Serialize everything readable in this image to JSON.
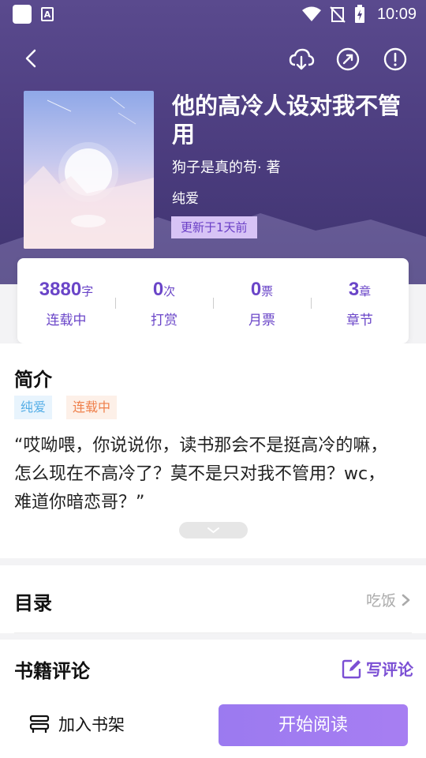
{
  "status_bar": {
    "time": "10:09"
  },
  "book": {
    "title": "他的高冷人设对我不管用",
    "author": "狗子是真的苟· 著",
    "genre": "纯爱",
    "updated": "更新于1天前"
  },
  "stats": [
    {
      "value": "3880",
      "unit": "字",
      "label": "连载中"
    },
    {
      "value": "0",
      "unit": "次",
      "label": "打赏"
    },
    {
      "value": "0",
      "unit": "票",
      "label": "月票"
    },
    {
      "value": "3",
      "unit": "章",
      "label": "章节"
    }
  ],
  "intro": {
    "title": "简介",
    "tags": [
      "纯爱",
      "连载中"
    ],
    "text": "“哎呦喂，你说说你，读书那会不是挺高冷的嘛，怎么现在不高冷了？莫不是只对我不管用？wc，难道你暗恋哥？”"
  },
  "toc": {
    "title": "目录",
    "latest": "吃饭"
  },
  "comments": {
    "title": "书籍评论",
    "write_label": "写评论"
  },
  "bottom": {
    "shelf_label": "加入书架",
    "read_label": "开始阅读"
  },
  "colors": {
    "accent": "#6a45c8",
    "hero": "#4b3c7e",
    "read_button": "#9b7af0"
  }
}
